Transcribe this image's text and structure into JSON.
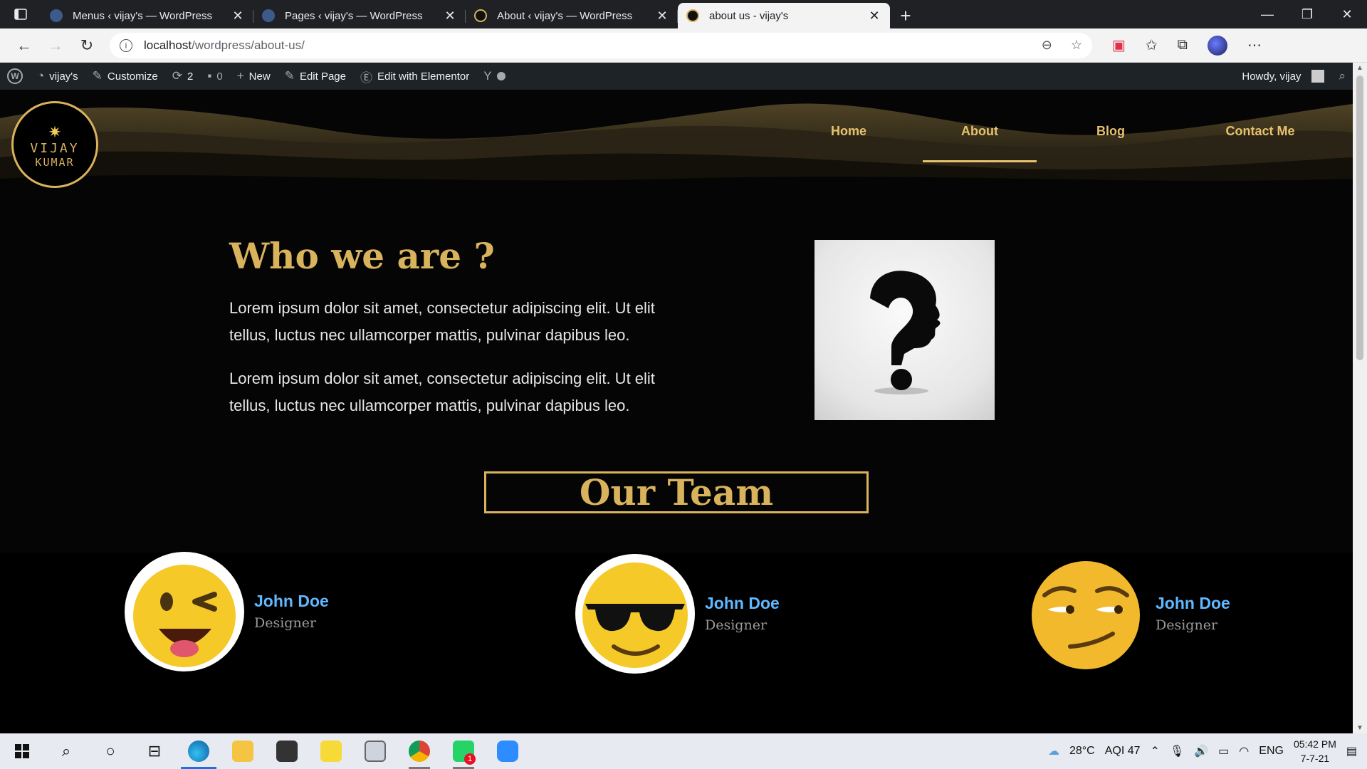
{
  "browser": {
    "tabs": [
      {
        "title": "Menus ‹ vijay's — WordPress",
        "active": false
      },
      {
        "title": "Pages ‹ vijay's — WordPress",
        "active": false
      },
      {
        "title": "About ‹ vijay's — WordPress",
        "active": false
      },
      {
        "title": "about us - vijay's",
        "active": true
      }
    ],
    "url_host": "localhost",
    "url_path": "/wordpress/about-us/"
  },
  "wp_admin_bar": {
    "site_name": "vijay's",
    "customize": "Customize",
    "updates_count": "2",
    "comments_count": "0",
    "new": "New",
    "edit_page": "Edit Page",
    "edit_elementor": "Edit with Elementor",
    "howdy": "Howdy, vijay"
  },
  "site": {
    "logo_line1": "VIJAY",
    "logo_line2": "KUMAR",
    "menu": [
      {
        "label": "Home",
        "active": false
      },
      {
        "label": "About",
        "active": true
      },
      {
        "label": "Blog",
        "active": false
      },
      {
        "label": "Contact Me",
        "active": false
      }
    ],
    "accent_color": "#d9b25c"
  },
  "about": {
    "title": "Who we are ?",
    "paragraph1": "Lorem ipsum dolor sit amet, consectetur adipiscing elit. Ut elit tellus, luctus nec ullamcorper mattis, pulvinar dapibus leo.",
    "paragraph2": "Lorem ipsum dolor sit amet, consectetur adipiscing elit. Ut elit tellus, luctus nec ullamcorper mattis, pulvinar dapibus leo.",
    "image_icon": "question-head-icon"
  },
  "team": {
    "title": "Our Team",
    "members": [
      {
        "name": "John Doe",
        "role": "Designer",
        "avatar": "winking-emoji"
      },
      {
        "name": "John Doe",
        "role": "Designer",
        "avatar": "sunglasses-emoji"
      },
      {
        "name": "John Doe",
        "role": "Designer",
        "avatar": "smirk-emoji"
      }
    ]
  },
  "taskbar": {
    "weather": "28°C",
    "aqi": "AQI 47",
    "language": "ENG",
    "time": "05:42 PM",
    "date": "7-7-21",
    "whatsapp_badge": "1"
  }
}
